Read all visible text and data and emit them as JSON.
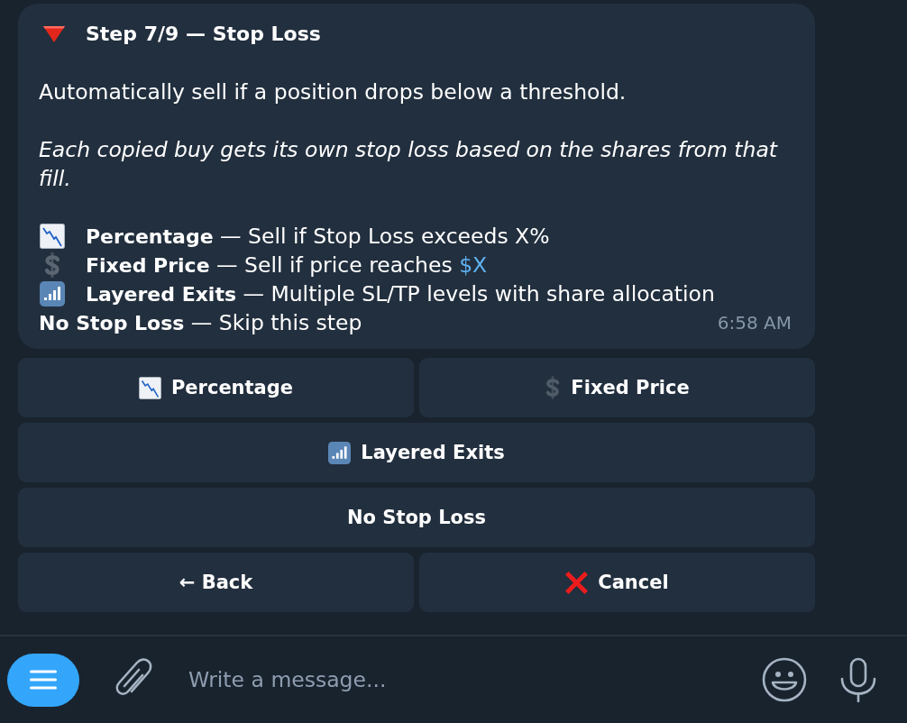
{
  "message": {
    "title": "Step 7/9 — Stop Loss",
    "intro": "Automatically sell if a position drops below a threshold.",
    "note": "Each copied buy gets its own stop loss based on the shares from that fill.",
    "options": [
      {
        "kind": "chart",
        "text": "**Percentage** — Sell if Stop Loss exceeds X%"
      },
      {
        "kind": "dollar",
        "text": "**Fixed Price** — Sell if price reaches",
        "link": "$X"
      },
      {
        "kind": "signal",
        "text": "**Layered Exits** — Multiple SL/TP levels with share allocation"
      },
      {
        "kind": "plain",
        "text": "**No Stop Loss** — Skip this step"
      }
    ],
    "time": "6:58 AM"
  },
  "keyboard": {
    "rows": [
      {
        "buttons": [
          {
            "kind": "chart",
            "label": "Percentage"
          },
          {
            "kind": "dollar",
            "label": "Fixed Price"
          }
        ]
      },
      {
        "buttons": [
          {
            "kind": "signal",
            "label": "Layered Exits"
          }
        ]
      },
      {
        "buttons": [
          {
            "kind": "plain",
            "label": "No Stop Loss"
          }
        ]
      },
      {
        "buttons": [
          {
            "kind": "plain",
            "label": "← Back"
          },
          {
            "kind": "cross",
            "label": "Cancel"
          }
        ]
      }
    ]
  },
  "composer": {
    "placeholder": "Write a message..."
  }
}
